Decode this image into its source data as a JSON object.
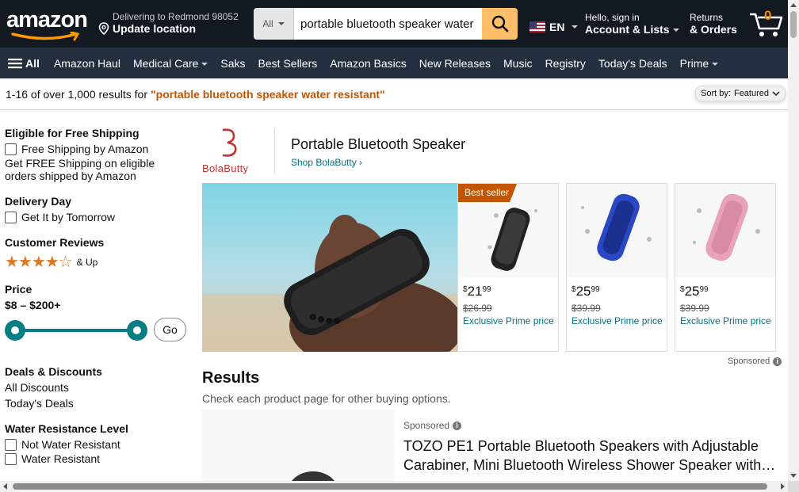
{
  "header": {
    "logo_text": "amazon",
    "deliver_line1": "Delivering to Redmond 98052",
    "deliver_line2": "Update location",
    "search_category": "All",
    "search_value": "portable bluetooth speaker water resistant",
    "language": "EN",
    "account_line1": "Hello, sign in",
    "account_line2": "Account & Lists",
    "returns_line1": "Returns",
    "returns_line2": "& Orders",
    "cart_count": "0"
  },
  "subnav": {
    "all_label": "All",
    "items": [
      "Amazon Haul",
      "Medical Care",
      "Saks",
      "Best Sellers",
      "Amazon Basics",
      "New Releases",
      "Music",
      "Registry",
      "Today's Deals",
      "Prime"
    ]
  },
  "results_bar": {
    "count_text": "1-16 of over 1,000 results for",
    "query": "\"portable bluetooth speaker water resistant\"",
    "sort_label": "Sort by:",
    "sort_value": "Featured"
  },
  "sidebar": {
    "free_shipping_heading": "Eligible for Free Shipping",
    "free_shipping_option": "Free Shipping by Amazon",
    "free_shipping_desc": "Get FREE Shipping on eligible orders shipped by Amazon",
    "delivery_heading": "Delivery Day",
    "delivery_option": "Get It by Tomorrow",
    "reviews_heading": "Customer Reviews",
    "reviews_stars": 4,
    "reviews_suffix": "& Up",
    "price_heading": "Price",
    "price_range": "$8 – $200+",
    "go_label": "Go",
    "deals_heading": "Deals & Discounts",
    "deals_all": "All Discounts",
    "deals_today": "Today's Deals",
    "water_heading": "Water Resistance Level",
    "water_opt1": "Not Water Resistant",
    "water_opt2": "Water Resistant"
  },
  "brand": {
    "logo_text": "BolaButty",
    "title": "Portable Bluetooth Speaker",
    "shop_link": "Shop BolaButty ›"
  },
  "products": [
    {
      "badge": "Best seller",
      "price_whole": "21",
      "price_frac": "99",
      "was": "$26.99",
      "prime": "Exclusive Prime price",
      "color": "#2a2a2a"
    },
    {
      "badge": "",
      "price_whole": "25",
      "price_frac": "99",
      "was": "$39.99",
      "prime": "Exclusive Prime price",
      "color": "#2a47c4"
    },
    {
      "badge": "",
      "price_whole": "25",
      "price_frac": "99",
      "was": "$39.99",
      "prime": "Exclusive Prime price",
      "color": "#e9a3b8"
    }
  ],
  "sponsored_label": "Sponsored",
  "results": {
    "heading": "Results",
    "subheading": "Check each product page for other buying options.",
    "first_sponsored": "Sponsored",
    "first_title": "TOZO PE1 Portable Bluetooth Speakers with Adjustable Carabiner, Mini Bluetooth Wireless Shower Speaker with…"
  },
  "colors": {
    "nav_dark": "#131921",
    "nav_sub": "#232f3e",
    "search_button": "#febd69",
    "link": "#007185",
    "query_orange": "#c45500",
    "star": "#de7921",
    "slider_teal": "#067d84"
  }
}
